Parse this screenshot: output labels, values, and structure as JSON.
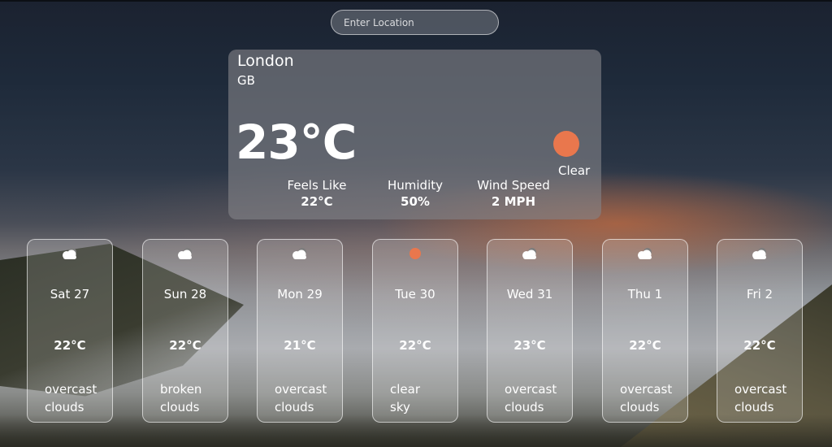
{
  "search": {
    "placeholder": "Enter Location"
  },
  "current": {
    "city": "London",
    "country": "GB",
    "temperature": "23°C",
    "condition": "Clear",
    "icon": "sun-icon",
    "stats": {
      "feels_like": {
        "label": "Feels Like",
        "value": "22°C"
      },
      "humidity": {
        "label": "Humidity",
        "value": "50%"
      },
      "wind": {
        "label": "Wind Speed",
        "value": "2 MPH"
      }
    }
  },
  "forecast": [
    {
      "day": "Sat 27",
      "temp": "22°C",
      "desc1": "overcast",
      "desc2": "clouds",
      "icon": "cloud-icon"
    },
    {
      "day": "Sun 28",
      "temp": "22°C",
      "desc1": "broken",
      "desc2": "clouds",
      "icon": "cloud-icon"
    },
    {
      "day": "Mon 29",
      "temp": "21°C",
      "desc1": "overcast",
      "desc2": "clouds",
      "icon": "cloud-icon"
    },
    {
      "day": "Tue 30",
      "temp": "22°C",
      "desc1": "clear",
      "desc2": "sky",
      "icon": "sun-icon"
    },
    {
      "day": "Wed 31",
      "temp": "23°C",
      "desc1": "overcast",
      "desc2": "clouds",
      "icon": "cloud-icon"
    },
    {
      "day": "Thu 1",
      "temp": "22°C",
      "desc1": "overcast",
      "desc2": "clouds",
      "icon": "cloud-icon"
    },
    {
      "day": "Fri 2",
      "temp": "22°C",
      "desc1": "overcast",
      "desc2": "clouds",
      "icon": "cloud-icon"
    }
  ],
  "colors": {
    "sun": "#e9774d",
    "card": "#828287"
  }
}
